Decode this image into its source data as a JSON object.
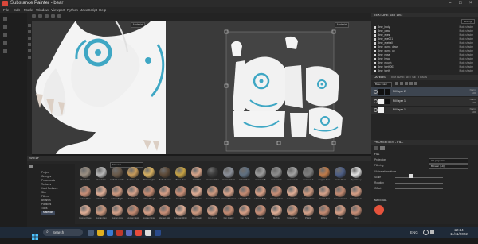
{
  "window": {
    "title": "Substance Painter - bear",
    "accent": "#d8473a"
  },
  "menu": [
    "File",
    "Edit",
    "Mode",
    "Window",
    "Viewport",
    "Python",
    "JavaScript",
    "Help"
  ],
  "viewport3d": {
    "dropdown": "Material"
  },
  "viewport2d": {
    "dropdown": "Material"
  },
  "texture_set_list": {
    "header": "TEXTURE SET LIST",
    "settings_label": "Settings",
    "items": [
      {
        "name": "Bear_body",
        "shader": "Main shader"
      },
      {
        "name": "Bear_claw",
        "shader": "Main shader"
      },
      {
        "name": "Bear_eyes",
        "shader": "Main shader"
      },
      {
        "name": "Bear_eye001",
        "shader": "Main shader"
      },
      {
        "name": "Bear_eyeball",
        "shader": "Main shader"
      },
      {
        "name": "Bear_gums_down",
        "shader": "Main shader"
      },
      {
        "name": "Bear_gums_up",
        "shader": "Main shader"
      },
      {
        "name": "Bear_nose",
        "shader": "Main shader"
      },
      {
        "name": "Bear_head",
        "shader": "Main shader"
      },
      {
        "name": "Bear_mouth",
        "shader": "Main shader"
      },
      {
        "name": "Bear_teeth001",
        "shader": "Main shader"
      },
      {
        "name": "Bear_teeth",
        "shader": "Main shader"
      }
    ]
  },
  "layers": {
    "tab1": "LAYERS",
    "tab2": "TEXTURE SET SETTINGS",
    "base_color": "Base Color",
    "rows": [
      {
        "name": "Fill layer 2",
        "blend": "Norm",
        "opacity": "100"
      },
      {
        "name": "Fill layer 1",
        "blend": "Norm",
        "opacity": "100"
      },
      {
        "name": "Fill layer 1",
        "blend": "Norm",
        "opacity": "100"
      }
    ]
  },
  "properties": {
    "header": "PROPERTIES - FILL",
    "section_fill": "FILL",
    "projection_label": "Projection",
    "projection_value": "UV projection",
    "filtering_label": "Filtering",
    "filtering_value": "Bilinear | HQ",
    "uv_section": "UV transformations",
    "scale_label": "Scale",
    "rotation_label": "Rotation",
    "offset_label": "Offset",
    "material_section": "MATERIAL"
  },
  "shelf": {
    "header": "SHELF",
    "search_placeholder": "Material",
    "folders": [
      "Project",
      "Grunges",
      "Procedurals",
      "Textures",
      "Hard Surfaces",
      "Skin",
      "Filters",
      "Brushes",
      "Particles",
      "Tools",
      "Materials"
    ],
    "selected_folder": "Materials",
    "row1": [
      "Aluminium",
      "Aluminium",
      "Artificial Leather",
      "Autumn Leaf",
      "Baked Light",
      "Bark Vegetal",
      "Brass Pure",
      "Calf Skin",
      "Carbon Fiber",
      "Coated Metal",
      "Cobalt Pure",
      "Concrete B",
      "Concrete C",
      "Concrete D",
      "Concrete E",
      "Copper Pure",
      "Denim Rivet",
      "Eye Heavy"
    ],
    "row2": [
      "Fabric Bam",
      "Fabric Base",
      "Fabric Bright",
      "Fabric Knit",
      "Fabric Rough",
      "Fabric Suede",
      "Footprints",
      "Gold Pure",
      "Gouache Paint",
      "Ground Gravel",
      "Human Back",
      "Human Belly",
      "Human Chest",
      "Human Eye",
      "Human Face",
      "Human Feet",
      "Human Hand",
      "Human Head"
    ],
    "row3": [
      "Human Knee",
      "Human Leg",
      "Human Lips",
      "Human Neck",
      "Human Nose",
      "Human Skin",
      "Human Wrist",
      "Iron Chain",
      "Iron Forge",
      "Iron Grainy",
      "Iron Pure",
      "Leather",
      "Marble",
      "Nickel Pure",
      "Plastic",
      "Rubber",
      "Silver",
      "Skin"
    ]
  },
  "taskbar": {
    "search_placeholder": "Search",
    "lang": "ENG",
    "time": "22:44",
    "date": "11/11/2022"
  }
}
